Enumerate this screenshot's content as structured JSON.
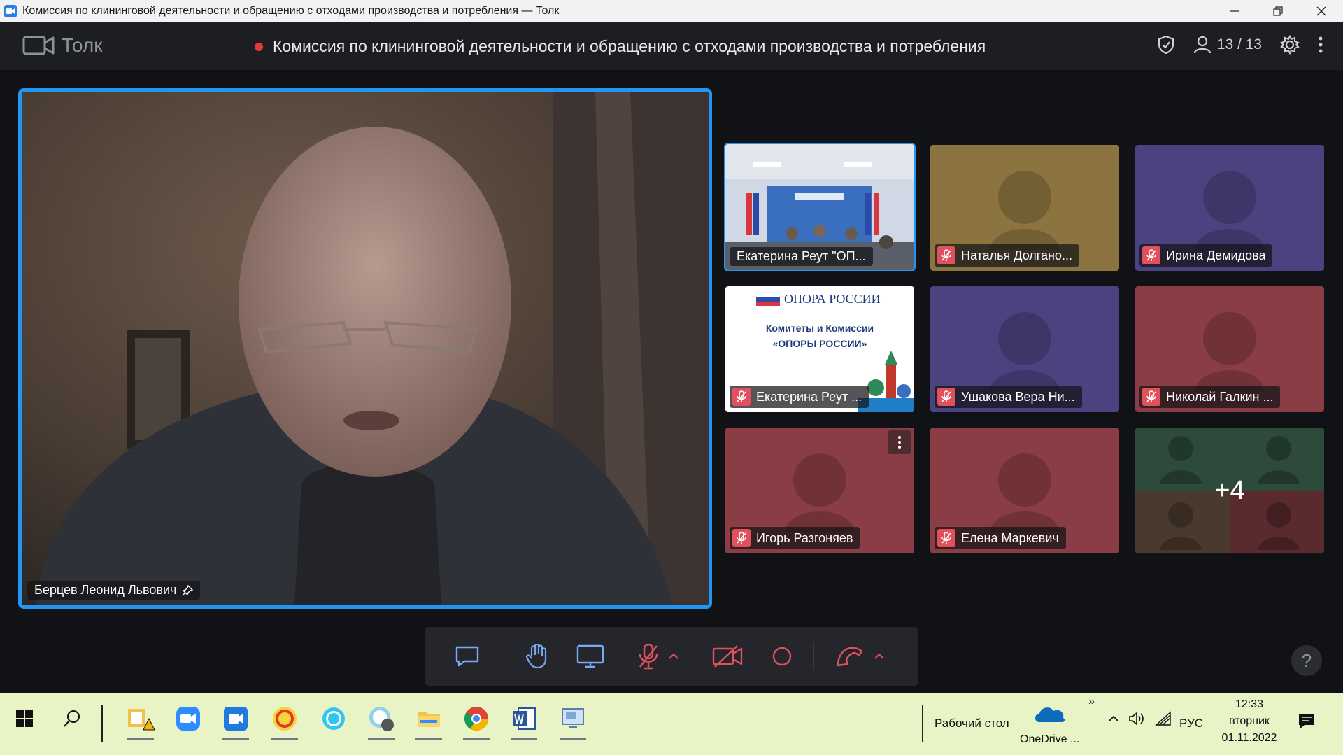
{
  "window": {
    "title": "Комиссия по клининговой деятельности и обращению с отходами производства и потребления — Толк"
  },
  "header": {
    "brand": "Толк",
    "meeting_title": "Комиссия по клининговой деятельности и обращению с отходами производства и потребления",
    "participants": "13 / 13",
    "recording_color": "#e33b3b"
  },
  "main_speaker": {
    "name": "Берцев Леонид Львович"
  },
  "tiles": [
    {
      "name": "Екатерина Реут \"ОП...",
      "muted": false,
      "bg": "room-video",
      "active": true
    },
    {
      "name": "Наталья Долгано...",
      "muted": true,
      "bg": "#8b7440"
    },
    {
      "name": "Ирина Демидова",
      "muted": true,
      "bg": "#4b4380"
    },
    {
      "name": "Екатерина Реут ...",
      "muted": true,
      "bg": "slide"
    },
    {
      "name": "Ушакова Вера Ни...",
      "muted": true,
      "bg": "#4b4380"
    },
    {
      "name": "Николай Галкин ...",
      "muted": true,
      "bg": "#8a3d44"
    },
    {
      "name": "Игорь Разгоняев",
      "muted": true,
      "bg": "#8a3d44"
    },
    {
      "name": "Елена Маркевич",
      "muted": true,
      "bg": "#8a3d44"
    },
    {
      "more": "+4"
    }
  ],
  "slide": {
    "org": "ОПОРА РОССИИ",
    "line1": "Комитеты и Комиссии",
    "line2": "«ОПОРЫ РОССИИ»"
  },
  "toolbar": {
    "buttons": [
      "chat",
      "raise-hand",
      "screen-share",
      "microphone",
      "camera",
      "record",
      "leave"
    ]
  },
  "help": "?",
  "taskbar": {
    "desktop_label": "Рабочий стол",
    "onedrive_label": "OneDrive ...",
    "language": "РУС",
    "time": "12:33",
    "day": "вторник",
    "date": "01.11.2022",
    "chevron": "»"
  }
}
